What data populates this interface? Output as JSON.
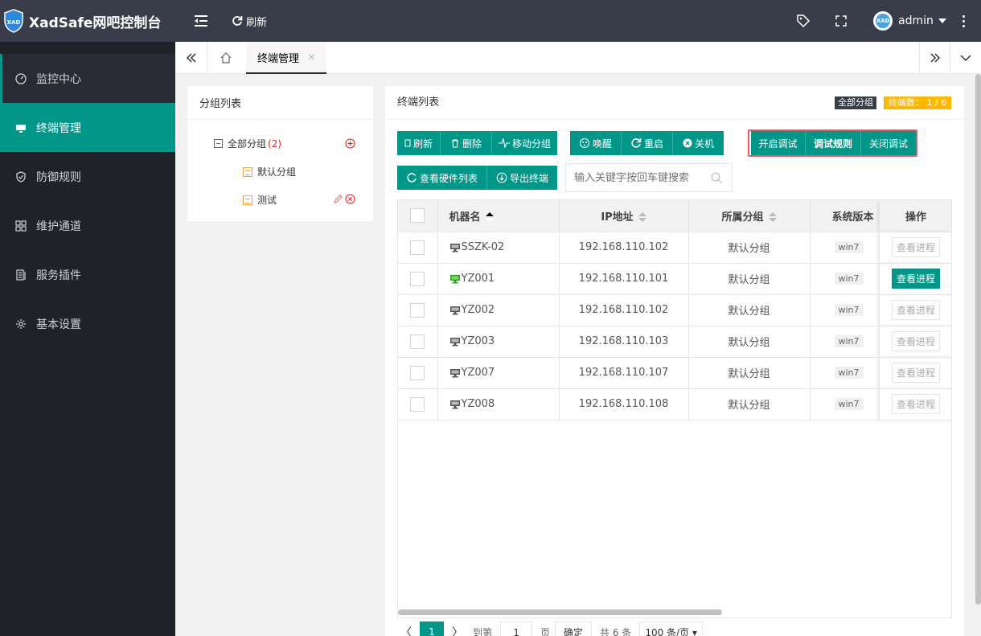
{
  "app": {
    "title": "XadSafe网吧控制台",
    "logo_text": "XAD"
  },
  "header": {
    "refresh_label": "刷新",
    "user": "admin"
  },
  "sidebar": {
    "items": [
      {
        "label": "监控中心",
        "icon": "dashboard-icon"
      },
      {
        "label": "终端管理",
        "icon": "monitor-icon"
      },
      {
        "label": "防御规则",
        "icon": "shield-icon"
      },
      {
        "label": "维护通道",
        "icon": "apps-icon"
      },
      {
        "label": "服务插件",
        "icon": "plugin-icon"
      },
      {
        "label": "基本设置",
        "icon": "gear-icon"
      }
    ]
  },
  "tabs": {
    "active": "终端管理",
    "close": "×"
  },
  "group_panel": {
    "title": "分组列表",
    "root": {
      "label": "全部分组",
      "count": "(2)"
    },
    "children": [
      "默认分组",
      "测试"
    ]
  },
  "terminal_panel": {
    "title": "终端列表",
    "badge_group": "全部分组",
    "badge_count": "终端数： 1 / 6",
    "toolbar1": [
      "刷新",
      "删除",
      "移动分组"
    ],
    "toolbar2": [
      "唤醒",
      "重启",
      "关机"
    ],
    "toolbar3": [
      "开启调试",
      "调试规则",
      "关闭调试"
    ],
    "toolbar4": [
      "查看硬件列表",
      "导出终端"
    ],
    "search_placeholder": "输入关键字按回车键搜索"
  },
  "table": {
    "headers": [
      "机器名",
      "IP地址",
      "所属分组",
      "系统版本",
      "操作"
    ],
    "rows": [
      {
        "name": "SSZK-02",
        "ip": "192.168.110.102",
        "group": "默认分组",
        "os": "win7",
        "action": "查看进程",
        "online": false
      },
      {
        "name": "YZ001",
        "ip": "192.168.110.101",
        "group": "默认分组",
        "os": "win7",
        "action": "查看进程",
        "online": true
      },
      {
        "name": "YZ002",
        "ip": "192.168.110.102",
        "group": "默认分组",
        "os": "win7",
        "action": "查看进程",
        "online": false
      },
      {
        "name": "YZ003",
        "ip": "192.168.110.103",
        "group": "默认分组",
        "os": "win7",
        "action": "查看进程",
        "online": false
      },
      {
        "name": "YZ007",
        "ip": "192.168.110.107",
        "group": "默认分组",
        "os": "win7",
        "action": "查看进程",
        "online": false
      },
      {
        "name": "YZ008",
        "ip": "192.168.110.108",
        "group": "默认分组",
        "os": "win7",
        "action": "查看进程",
        "online": false
      }
    ]
  },
  "pager": {
    "prev": "〈",
    "next": "〉",
    "current": "1",
    "goto_label": "到第",
    "goto_value": "1",
    "page_unit": "页",
    "confirm": "确定",
    "total": "共 6 条",
    "page_size": "100 条/页"
  },
  "colors": {
    "accent": "#009688",
    "header": "#393d49",
    "sidebar": "#20222a",
    "warn": "#ffb800",
    "danger": "#e02020"
  }
}
